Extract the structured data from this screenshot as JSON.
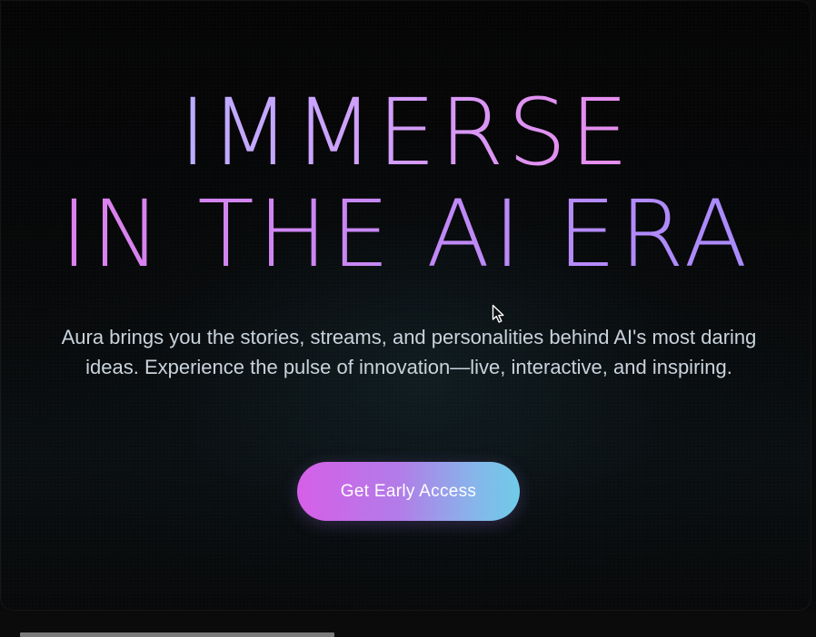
{
  "hero": {
    "headline_line1": "IMMERSE",
    "headline_line2": "IN THE AI ERA",
    "subtitle": "Aura brings you the stories, streams, and personalities behind AI's most daring ideas. Experience the pulse of innovation—live, interactive, and inspiring.",
    "cta_label": "Get Early Access"
  },
  "colors": {
    "background": "#050506",
    "headline_gradient_start": "#a9b8ff",
    "headline_gradient_end": "#a58bff",
    "cta_gradient_start": "#d65fe8",
    "cta_gradient_end": "#6fcbe8",
    "subtitle_text": "#c9d3dc"
  },
  "icons": {
    "pointer": "mouse-pointer-icon"
  }
}
